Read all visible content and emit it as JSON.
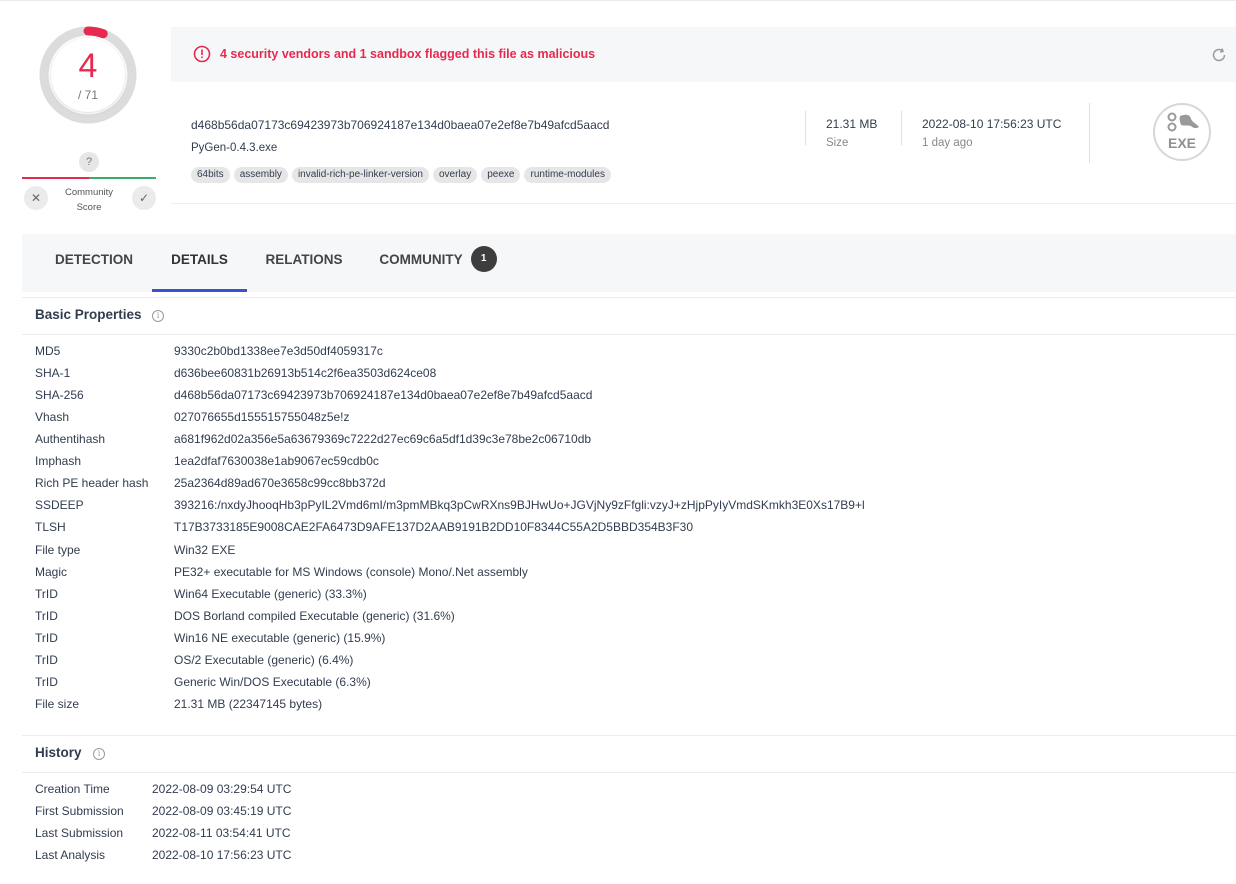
{
  "score": {
    "detections": "4",
    "total": "/ 71",
    "detections_fraction": 0.0563,
    "accent": "#e8294f"
  },
  "community": {
    "badge": "?",
    "label_line1": "Community",
    "label_line2": "Score"
  },
  "alert": {
    "text": "4 security vendors and 1 sandbox flagged this file as malicious"
  },
  "file": {
    "hash": "d468b56da07173c69423973b706924187e134d0baea07e2ef8e7b49afcd5aacd",
    "name": "PyGen-0.4.3.exe",
    "tags": [
      "64bits",
      "assembly",
      "invalid-rich-pe-linker-version",
      "overlay",
      "peexe",
      "runtime-modules"
    ],
    "size_value": "21.31 MB",
    "size_label": "Size",
    "date_value": "2022-08-10 17:56:23 UTC",
    "date_label": "1 day ago",
    "type_icon_text": "EXE"
  },
  "tabs": [
    {
      "label": "DETECTION"
    },
    {
      "label": "DETAILS"
    },
    {
      "label": "RELATIONS"
    },
    {
      "label": "COMMUNITY",
      "badge": "1"
    }
  ],
  "basic_properties": {
    "title": "Basic Properties",
    "rows": [
      {
        "key": "MD5",
        "value": "9330c2b0bd1338ee7e3d50df4059317c"
      },
      {
        "key": "SHA-1",
        "value": "d636bee60831b26913b514c2f6ea3503d624ce08"
      },
      {
        "key": "SHA-256",
        "value": "d468b56da07173c69423973b706924187e134d0baea07e2ef8e7b49afcd5aacd"
      },
      {
        "key": "Vhash",
        "value": "027076655d155515755048z5e!z"
      },
      {
        "key": "Authentihash",
        "value": "a681f962d02a356e5a63679369c7222d27ec69c6a5df1d39c3e78be2c06710db"
      },
      {
        "key": "Imphash",
        "value": "1ea2dfaf7630038e1ab9067ec59cdb0c"
      },
      {
        "key": "Rich PE header hash",
        "value": "25a2364d89ad670e3658c99cc8bb372d"
      },
      {
        "key": "SSDEEP",
        "value": "393216:/nxdyJhooqHb3pPyIL2Vmd6mI/m3pmMBkq3pCwRXns9BJHwUo+JGVjNy9zFfgli:vzyJ+zHjpPyIyVmdSKmkh3E0Xs17B9+l"
      },
      {
        "key": "TLSH",
        "value": "T17B3733185E9008CAE2FA6473D9AFE137D2AAB9191B2DD10F8344C55A2D5BBD354B3F30"
      },
      {
        "key": "File type",
        "value": "Win32 EXE"
      },
      {
        "key": "Magic",
        "value": "PE32+ executable for MS Windows (console) Mono/.Net assembly"
      },
      {
        "key": "TrID",
        "value": "Win64 Executable (generic) (33.3%)"
      },
      {
        "key": "TrID",
        "value": "DOS Borland compiled Executable (generic) (31.6%)"
      },
      {
        "key": "TrID",
        "value": "Win16 NE executable (generic) (15.9%)"
      },
      {
        "key": "TrID",
        "value": "OS/2 Executable (generic) (6.4%)"
      },
      {
        "key": "TrID",
        "value": "Generic Win/DOS Executable (6.3%)"
      },
      {
        "key": "File size",
        "value": "21.31 MB (22347145 bytes)"
      }
    ]
  },
  "history": {
    "title": "History",
    "rows": [
      {
        "key": "Creation Time",
        "value": "2022-08-09 03:29:54 UTC"
      },
      {
        "key": "First Submission",
        "value": "2022-08-09 03:45:19 UTC"
      },
      {
        "key": "Last Submission",
        "value": "2022-08-11 03:54:41 UTC"
      },
      {
        "key": "Last Analysis",
        "value": "2022-08-10 17:56:23 UTC"
      }
    ]
  }
}
